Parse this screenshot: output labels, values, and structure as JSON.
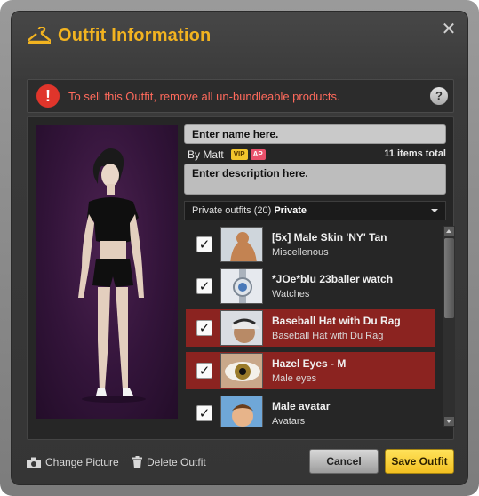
{
  "window": {
    "title": "Outfit Information",
    "close_glyph": "✕"
  },
  "warning": {
    "text": "To sell this Outfit, remove all un-bundleable products.",
    "alert_glyph": "!",
    "help_glyph": "?"
  },
  "outfit": {
    "name_placeholder": "Enter name here.",
    "by_line": "By Matt",
    "vip_badge": "VIP",
    "ap_badge": "AP",
    "items_total": "11 items total",
    "description_placeholder": "Enter description here.",
    "folder_label": "Private outfits (20)",
    "folder_value": "Private"
  },
  "items": [
    {
      "name": "[5x] Male Skin 'NY' Tan",
      "category": "Miscellenous",
      "checked": true,
      "selected": false
    },
    {
      "name": "*JOe*blu 23baller watch",
      "category": "Watches",
      "checked": true,
      "selected": false
    },
    {
      "name": "Baseball Hat with Du Rag",
      "category": "Baseball Hat with Du Rag",
      "checked": true,
      "selected": true
    },
    {
      "name": "Hazel Eyes - M",
      "category": "Male eyes",
      "checked": true,
      "selected": true
    },
    {
      "name": "Male avatar",
      "category": "Avatars",
      "checked": true,
      "selected": false
    }
  ],
  "footer": {
    "change_picture": "Change Picture",
    "delete_outfit": "Delete Outfit",
    "cancel": "Cancel",
    "save": "Save Outfit"
  },
  "colors": {
    "accent": "#f2b320",
    "warning_text": "#ff6a5c",
    "selected_row": "#8b2320",
    "save_button": "#f3c021"
  },
  "icons": [
    "hanger-icon",
    "close-icon",
    "alert-icon",
    "help-icon",
    "chevron-down-icon",
    "checkmark-icon",
    "camera-icon",
    "trash-icon"
  ]
}
